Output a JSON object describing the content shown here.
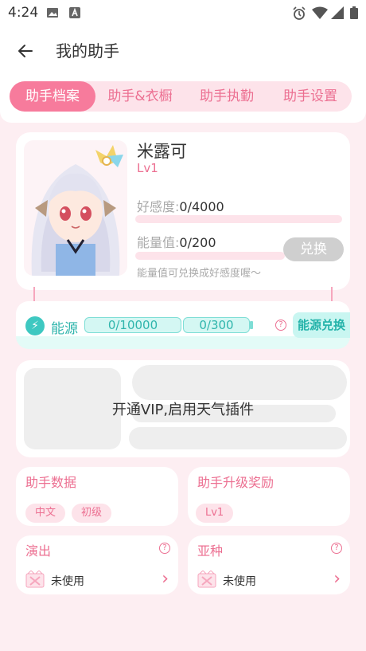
{
  "status": {
    "time": "4:24"
  },
  "header": {
    "title": "我的助手"
  },
  "tabs": [
    {
      "label": "助手档案",
      "active": true
    },
    {
      "label": "助手&衣橱"
    },
    {
      "label": "助手执勤"
    },
    {
      "label": "助手设置"
    }
  ],
  "profile": {
    "name": "米露可",
    "level": "Lv1",
    "favor_label": "好感度:",
    "favor_value": "0/4000",
    "favor_progress": 0,
    "energy_label": "能量值:",
    "energy_value": "0/200",
    "energy_progress": 0,
    "exchange_button": "兑换",
    "hint": "能量值可兑换成好感度喔～"
  },
  "energy": {
    "label": "能源",
    "gauge1": "0/10000",
    "gauge2": "0/300",
    "exchange_button": "能源兑换"
  },
  "weather": {
    "text": "开通VIP,启用天气插件"
  },
  "assistant_data": {
    "title": "助手数据",
    "chips": [
      "中文",
      "初级"
    ]
  },
  "upgrade_rewards": {
    "title": "助手升级奖励",
    "chip": "Lv1"
  },
  "performance": {
    "title": "演出",
    "status": "未使用"
  },
  "subspecies": {
    "title": "亚种",
    "status": "未使用"
  },
  "colors": {
    "accent": "#f77b9c",
    "teal": "#3ec8c1",
    "bg": "#fdeef2"
  }
}
